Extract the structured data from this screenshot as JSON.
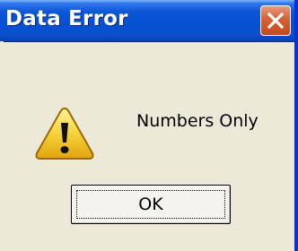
{
  "dialog": {
    "title": "Data Error",
    "close_icon": "close-icon",
    "message_icon": "warning-icon",
    "message": "Numbers Only",
    "ok_label": "OK"
  },
  "colors": {
    "titlebar": "#0550d2",
    "close_button": "#d6643c",
    "dialog_bg": "#ece9d8",
    "warning_yellow": "#f5d33a"
  }
}
